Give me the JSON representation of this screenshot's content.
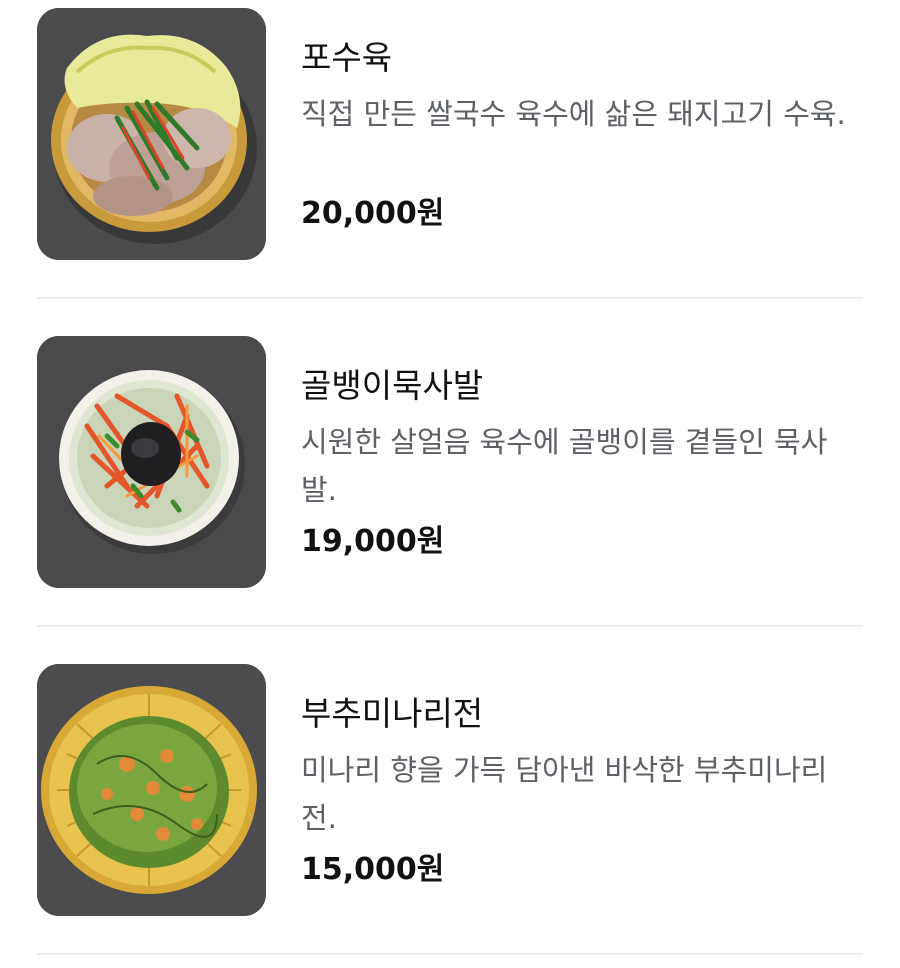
{
  "menu": {
    "items": [
      {
        "name": "포수육",
        "description": "직접 만든 쌀국수 육수에 삶은 돼지고기 수육.",
        "price": "20,000원",
        "image_icon": "boiled-pork-photo"
      },
      {
        "name": "골뱅이묵사발",
        "description": "시원한 살얼음 육수에 골뱅이를 곁들인 묵사발.",
        "price": "19,000원",
        "image_icon": "sea-snail-jelly-bowl-photo"
      },
      {
        "name": "부추미나리전",
        "description": "미나리 향을 가득 담아낸 바삭한 부추미나리전.",
        "price": "15,000원",
        "image_icon": "chive-pancake-photo"
      }
    ]
  },
  "colors": {
    "price_text": "#111111",
    "description_text": "#5d6166",
    "divider": "#eeeeee",
    "photo_background": "#4a4a4c"
  }
}
